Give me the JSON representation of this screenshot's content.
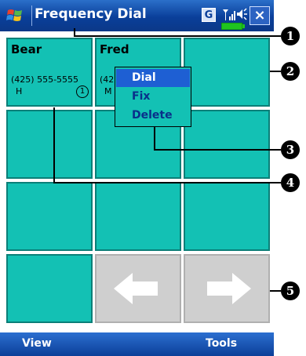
{
  "title": "Frequency Dial",
  "status_icons": {
    "data": "G",
    "signal": "signal-icon",
    "volume": "speaker-icon",
    "battery": "battery-icon",
    "close": "×"
  },
  "contacts": [
    {
      "name": "Bear",
      "phone": "(425) 555-5555",
      "type": "H",
      "index": "1"
    },
    {
      "name": "Fred",
      "phone": "(42",
      "type": "M"
    }
  ],
  "context_menu": {
    "items": [
      "Dial",
      "Fix",
      "Delete"
    ],
    "selected": "Dial"
  },
  "menubar": {
    "left": "View",
    "right": "Tools"
  },
  "callouts": [
    "1",
    "2",
    "3",
    "4",
    "5"
  ],
  "nav_buttons": {
    "prev": "left-arrow-icon",
    "next": "right-arrow-icon"
  }
}
